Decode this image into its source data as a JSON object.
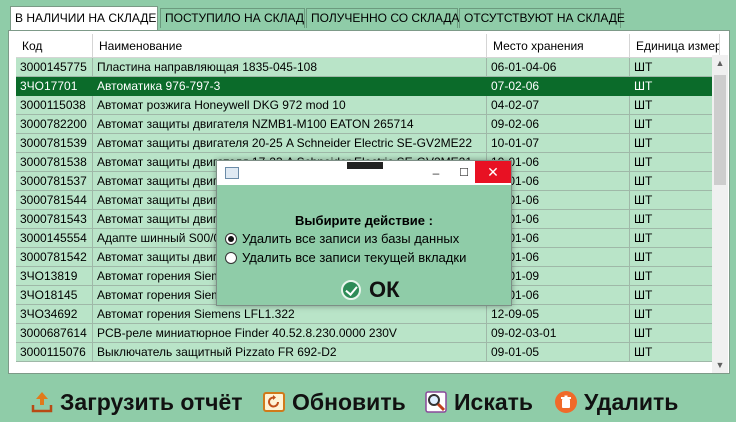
{
  "tabs": [
    {
      "label": "В НАЛИЧИИ НА СКЛАДЕ",
      "active": true
    },
    {
      "label": "ПОСТУПИЛО НА СКЛАД",
      "active": false
    },
    {
      "label": "ПОЛУЧЕННО СО СКЛАДА",
      "active": false
    },
    {
      "label": "ОТСУТСТВУЮТ НА СКЛАДЕ",
      "active": false
    }
  ],
  "table": {
    "columns": [
      "Код",
      "Наименование",
      "Место хранения",
      "Единица измер"
    ],
    "rows": [
      [
        "3000145775",
        " Пластина направляющая 1835-045-108",
        "06-01-04-06",
        "ШТ"
      ],
      [
        "3ЧО17701",
        "Автоматика 976-797-3",
        "07-02-06",
        "ШТ"
      ],
      [
        "3000115038",
        "Автомат розжига Honeywell DKG 972 mod 10",
        "04-02-07",
        "ШТ"
      ],
      [
        "3000782200",
        "Автомат защиты двигателя NZMB1-M100 EATON 265714",
        "09-02-06",
        "ШТ"
      ],
      [
        "3000781539",
        "Автомат защиты двигателя 20-25 A Schneider Electric SE-GV2ME22",
        "10-01-07",
        "ШТ"
      ],
      [
        "3000781538",
        "Автомат защиты двигателя 17-23 A Schneider Electric SE-GV2ME21",
        "10-01-06",
        "ШТ"
      ],
      [
        "3000781537",
        "Автомат защиты двигателя",
        "10-01-06",
        "ШТ"
      ],
      [
        "3000781544",
        "Автомат защиты двигателя",
        "10-01-06",
        "ШТ"
      ],
      [
        "3000781543",
        "Автомат защиты двигателя",
        "10-01-06",
        "ШТ"
      ],
      [
        "3000145554",
        "Адапте шинный S00/0",
        "10-01-06",
        "ШТ"
      ],
      [
        "3000781542",
        "Автомат защиты двигателя",
        "10-01-06",
        "ШТ"
      ],
      [
        "3ЧО13819",
        "Автомат горения Siemens",
        "10-01-09",
        "ШТ"
      ],
      [
        "3ЧО18145",
        "Автомат горения Siemens",
        "10-01-06",
        "ШТ"
      ],
      [
        "3ЧО34692",
        "Автомат горения Siemens LFL1.322",
        "12-09-05",
        "ШТ"
      ],
      [
        "3000687614",
        "PCB-реле миниатюрное Finder 40.52.8.230.0000 230V",
        "09-02-03-01",
        "ШТ"
      ],
      [
        "3000115076",
        "Выключатель защитный Pizzato FR 692-D2",
        "09-01-05",
        "ШТ"
      ]
    ],
    "selected_row": 1
  },
  "dialog": {
    "question": "Выбирите действие :",
    "options": [
      {
        "label": "Удалить все записи из базы данных",
        "checked": true
      },
      {
        "label": "Удалить все записи текущей вкладки",
        "checked": false
      }
    ],
    "ok_label": "ОК",
    "min_glyph": "–",
    "max_glyph": "☐",
    "close_glyph": "✕"
  },
  "toolbar": {
    "upload_label": "Загрузить отчёт",
    "refresh_label": "Обновить",
    "search_label": "Искать",
    "delete_label": "Удалить"
  },
  "colors": {
    "background": "#8fcca8",
    "row": "#b9e4c8",
    "selected_row": "#0b6b2a",
    "close_button": "#e81123"
  }
}
